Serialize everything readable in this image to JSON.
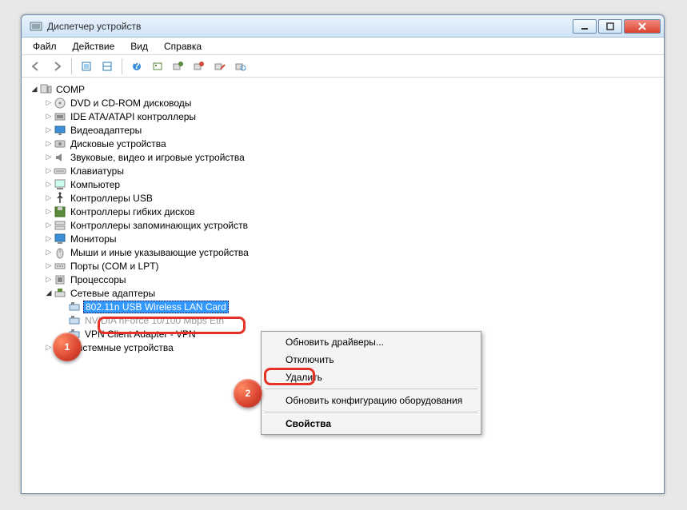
{
  "window": {
    "title": "Диспетчер устройств"
  },
  "menubar": [
    "Файл",
    "Действие",
    "Вид",
    "Справка"
  ],
  "tree": {
    "root": "COMP",
    "categories": [
      {
        "label": "DVD и CD-ROM дисководы",
        "icon": "disc"
      },
      {
        "label": "IDE ATA/ATAPI контроллеры",
        "icon": "ide"
      },
      {
        "label": "Видеоадаптеры",
        "icon": "display"
      },
      {
        "label": "Дисковые устройства",
        "icon": "hdd"
      },
      {
        "label": "Звуковые, видео и игровые устройства",
        "icon": "sound"
      },
      {
        "label": "Клавиатуры",
        "icon": "keyboard"
      },
      {
        "label": "Компьютер",
        "icon": "computer"
      },
      {
        "label": "Контроллеры USB",
        "icon": "usb"
      },
      {
        "label": "Контроллеры гибких дисков",
        "icon": "floppy"
      },
      {
        "label": "Контроллеры запоминающих устройств",
        "icon": "storage"
      },
      {
        "label": "Мониторы",
        "icon": "monitor"
      },
      {
        "label": "Мыши и иные указывающие устройства",
        "icon": "mouse"
      },
      {
        "label": "Порты (COM и LPT)",
        "icon": "port"
      },
      {
        "label": "Процессоры",
        "icon": "cpu"
      },
      {
        "label": "Сетевые адаптеры",
        "icon": "network",
        "expanded": true,
        "children": [
          {
            "label": "802.11n USB Wireless LAN Card",
            "icon": "netcard",
            "selected": true
          },
          {
            "label": "NVIDIA nForce 10/100 Mbps Eth",
            "icon": "netcard",
            "dimmed": true
          },
          {
            "label": "VPN Client Adapter - VPN",
            "icon": "netcard"
          }
        ]
      },
      {
        "label": "Системные устройства",
        "icon": "system"
      }
    ]
  },
  "context_menu": {
    "items": [
      {
        "label": "Обновить драйверы..."
      },
      {
        "label": "Отключить"
      },
      {
        "label": "Удалить",
        "highlighted": true
      },
      {
        "sep": true
      },
      {
        "label": "Обновить конфигурацию оборудования"
      },
      {
        "sep": true
      },
      {
        "label": "Свойства",
        "bold": true
      }
    ]
  },
  "callouts": {
    "one": "1",
    "two": "2"
  }
}
